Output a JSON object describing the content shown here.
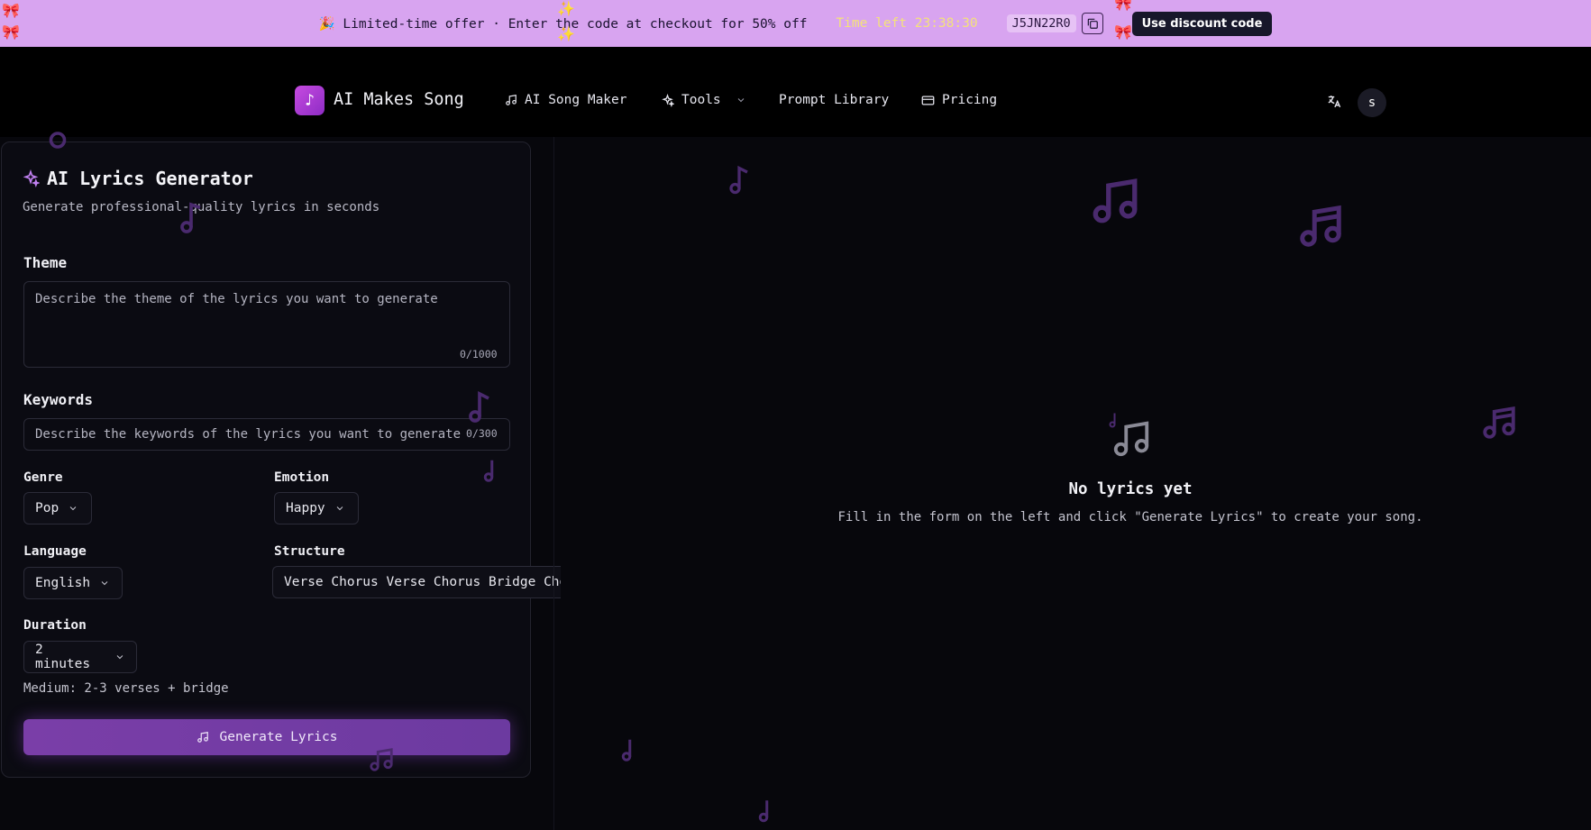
{
  "promo": {
    "text": "🎉 Limited-time offer · Enter the code at checkout for 50% off",
    "timer": "Time left 23:38:30",
    "code": "J5JN22R0",
    "button": "Use discount code"
  },
  "nav": {
    "brand": "AI Makes Song",
    "items": [
      "AI Song Maker",
      "Tools",
      "Prompt Library",
      "Pricing"
    ],
    "avatar": "s"
  },
  "form": {
    "title": "AI Lyrics Generator",
    "subtitle": "Generate professional-quality lyrics in seconds",
    "theme": {
      "label": "Theme",
      "placeholder": "Describe the theme of the lyrics you want to generate",
      "counter": "0/1000"
    },
    "keywords": {
      "label": "Keywords",
      "placeholder": "Describe the keywords of the lyrics you want to generate",
      "counter": "0/300"
    },
    "genre": {
      "label": "Genre",
      "value": "Pop"
    },
    "emotion": {
      "label": "Emotion",
      "value": "Happy"
    },
    "language": {
      "label": "Language",
      "value": "English"
    },
    "structure": {
      "label": "Structure",
      "value": "Verse Chorus Verse Chorus Bridge Chorus"
    },
    "duration": {
      "label": "Duration",
      "value": "2 minutes",
      "hint": "Medium: 2-3 verses + bridge"
    },
    "generate_button": "Generate Lyrics"
  },
  "empty_state": {
    "title": "No lyrics yet",
    "message": "Fill in the form on the left and click \"Generate Lyrics\" to create your song."
  },
  "colors": {
    "banner": "#d8a4f0",
    "accent": "#7a3ea8",
    "background": "#07070c",
    "note": "#4a2a6e"
  }
}
